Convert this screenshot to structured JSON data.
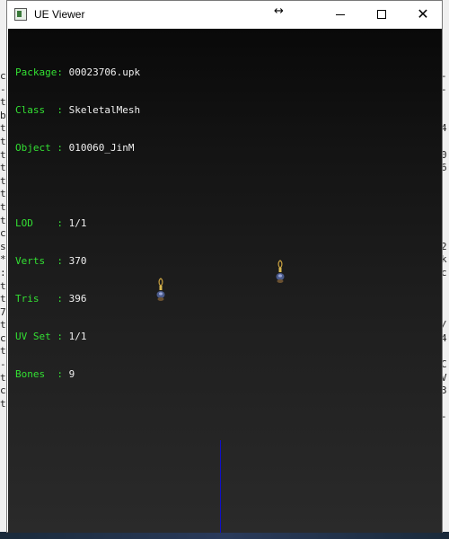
{
  "window": {
    "title": "UE Viewer",
    "cursor_glyph": "↔",
    "close_glyph": "✕"
  },
  "background_console": {
    "left_chars": "c\n-\nt\nb\nt\nt\nt\nt\nt\nt\nt\nt\nc\ns\n*\n:\nt\nt\n7\nt\nc\nt\n-\nt\nc\nt",
    "right_chars": "-\n-\n\n\n4\n\n0\n6\n\n\n\n\n\n2\nk\nc\n\n\n\n/\n4\n\nC\nV\n3\n\n-"
  },
  "info": {
    "package_label": "Package:",
    "package_value": "00023706.upk",
    "class_label": "Class  :",
    "class_value": "SkeletalMesh",
    "object_label": "Object :",
    "object_value": "010060_JinM",
    "lod_label": "LOD    :",
    "lod_value": "1/1",
    "verts_label": "Verts  :",
    "verts_value": "370",
    "tris_label": "Tris   :",
    "tris_value": "396",
    "uvset_label": "UV Set :",
    "uvset_value": "1/1",
    "bones_label": "Bones  :",
    "bones_value": "9"
  },
  "colors": {
    "label_green": "#33e033",
    "value_white": "#f0f0f0",
    "axis_blue": "#1010c8"
  }
}
